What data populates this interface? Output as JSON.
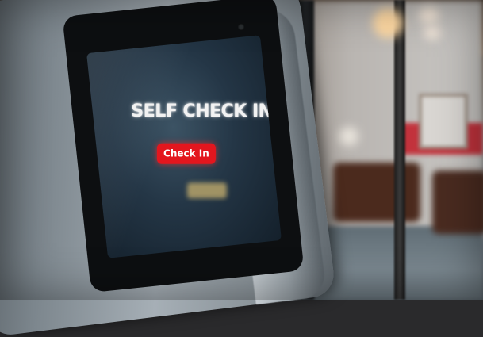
{
  "kiosk": {
    "screen_title": "SELF CHECK IN",
    "checkin_button_label": "Check In"
  },
  "colors": {
    "button_red": "#e3161e",
    "screen_background": "#243646",
    "wall_accent_red": "#c3242f"
  }
}
